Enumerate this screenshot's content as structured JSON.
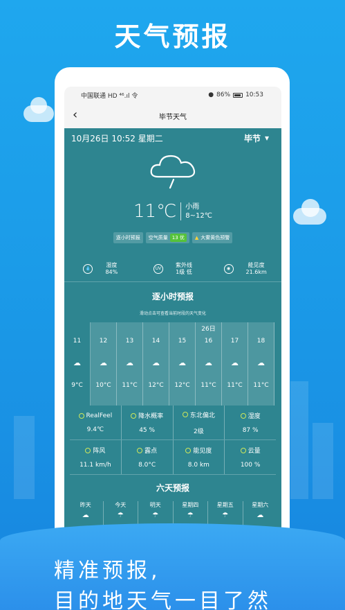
{
  "promo": {
    "title": "天气预报",
    "slogan_line1": "精准预报,",
    "slogan_line2": "目的地天气一目了然"
  },
  "status_bar": {
    "carrier": "中国联通 HD ⁴⁶.ıl 令",
    "right": "86%",
    "time": "10:53"
  },
  "nav": {
    "title": "毕节天气",
    "back_icon": "chevron-left-icon"
  },
  "weather": {
    "datetime": "10月26日 10:52 星期二",
    "city": "毕节",
    "temperature": "11℃",
    "condition": "小雨",
    "range": "8~12℃",
    "chips": {
      "hourly": "逐小时预报",
      "aqi_label": "空气质量",
      "aqi_value": "13 优",
      "warning": "大雾黄色预警"
    },
    "stats": [
      {
        "icon": "drop-icon",
        "label": "湿度",
        "value": "84%"
      },
      {
        "icon": "uv-icon",
        "label": "紫外线",
        "value": "1级 低"
      },
      {
        "icon": "eye-icon",
        "label": "能见度",
        "value": "21.6km"
      }
    ]
  },
  "hourly": {
    "title": "逐小时预报",
    "subtitle": "滑动点击可查看当前时段的天气变化",
    "date_marker": "26日",
    "items": [
      {
        "hour": "11",
        "temp": "9°C"
      },
      {
        "hour": "12",
        "temp": "10°C"
      },
      {
        "hour": "13",
        "temp": "11°C"
      },
      {
        "hour": "14",
        "temp": "12°C"
      },
      {
        "hour": "15",
        "temp": "12°C"
      },
      {
        "hour": "16",
        "temp": "11°C"
      },
      {
        "hour": "17",
        "temp": "11°C"
      },
      {
        "hour": "18",
        "temp": "11°C"
      }
    ]
  },
  "details": [
    {
      "label": "RealFeel",
      "value": "9.4℃"
    },
    {
      "label": "降水概率",
      "value": "45 %"
    },
    {
      "label": "东北偏北",
      "value": "2级"
    },
    {
      "label": "湿度",
      "value": "87 %"
    },
    {
      "label": "阵风",
      "value": "11.1 km/h"
    },
    {
      "label": "露点",
      "value": "8.0°C"
    },
    {
      "label": "能见度",
      "value": "8.0 km"
    },
    {
      "label": "云量",
      "value": "100 %"
    }
  ],
  "six_day": {
    "title": "六天预报",
    "days": [
      "昨天",
      "今天",
      "明天",
      "星期四",
      "星期五",
      "星期六"
    ]
  }
}
